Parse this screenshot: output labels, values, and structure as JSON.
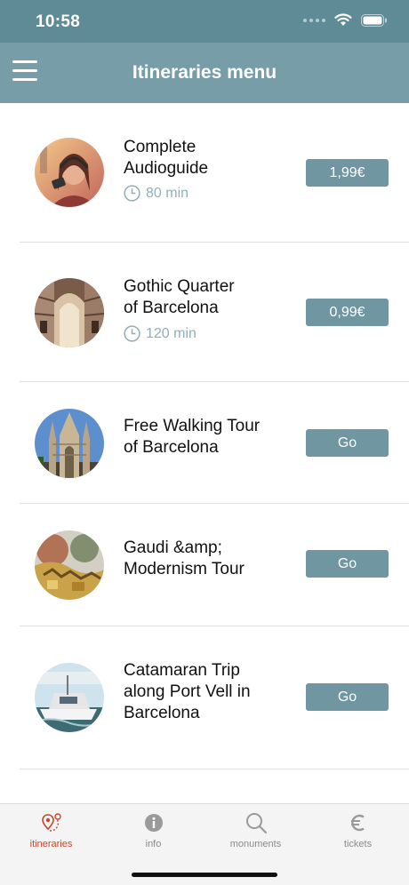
{
  "status_bar": {
    "time": "10:58"
  },
  "header": {
    "title": "Itineraries menu",
    "menu_icon": "hamburger-menu-icon"
  },
  "itineraries": [
    {
      "title_lines": [
        "Complete",
        "Audioguide"
      ],
      "duration": "80 min",
      "action": "1,99€",
      "thumb": "woman-with-headphones"
    },
    {
      "title_lines": [
        "Gothic Quarter",
        "of Barcelona"
      ],
      "duration": "120 min",
      "action": "0,99€",
      "thumb": "gothic-street-arch"
    },
    {
      "title_lines": [
        "Free Walking Tour",
        "of Barcelona"
      ],
      "duration": "",
      "action": "Go",
      "thumb": "barcelona-cathedral"
    },
    {
      "title_lines": [
        "Gaudi &amp;",
        "Modernism Tour"
      ],
      "duration": "",
      "action": "Go",
      "thumb": "gaudi-mosaic-sculpture"
    },
    {
      "title_lines": [
        "Catamaran Trip",
        "along Port Vell in",
        "Barcelona"
      ],
      "duration": "",
      "action": "Go",
      "thumb": "catamaran-boat"
    }
  ],
  "tabs": [
    {
      "label": "itineraries",
      "icon": "map-pin-route-icon",
      "active": true
    },
    {
      "label": "info",
      "icon": "info-icon",
      "active": false
    },
    {
      "label": "monuments",
      "icon": "search-icon",
      "active": false
    },
    {
      "label": "tickets",
      "icon": "euro-icon",
      "active": false
    }
  ],
  "colors": {
    "status_bar": "#5f8b97",
    "nav_bar": "#779da8",
    "button": "#6f96a1",
    "active_tab": "#c8462c",
    "duration_text": "#8fb0b7"
  }
}
